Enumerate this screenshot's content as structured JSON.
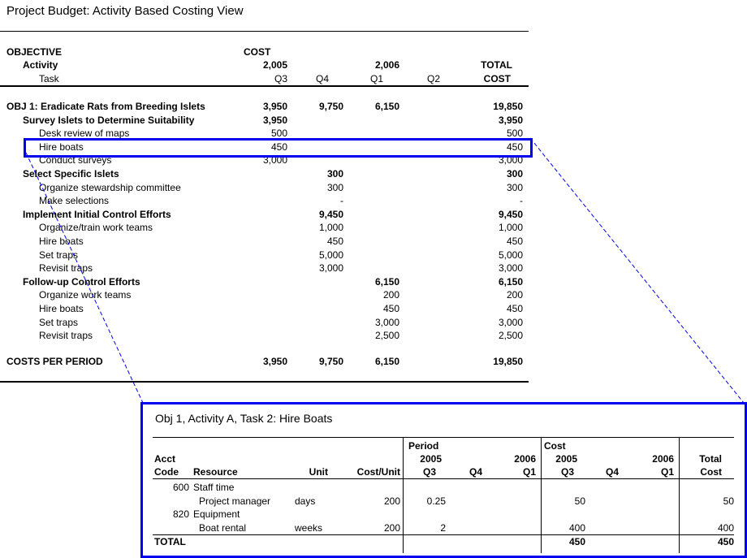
{
  "title": "Project Budget: Activity Based Costing View",
  "header": {
    "objective": "OBJECTIVE",
    "activity": "Activity",
    "task": "Task",
    "cost": "COST",
    "year_2005": "2,005",
    "year_2006": "2,006",
    "total": "TOTAL",
    "total_cost": "COST",
    "q3": "Q3",
    "q4": "Q4",
    "q1": "Q1",
    "q2": "Q2"
  },
  "rows": [
    {
      "label": "OBJ 1: Eradicate Rats from Breeding Islets",
      "level": 0,
      "q3": "3,950",
      "q4": "9,750",
      "q1": "6,150",
      "q2": "",
      "total": "19,850"
    },
    {
      "label": "Survey Islets to Determine Suitability",
      "level": 1,
      "q3": "3,950",
      "q4": "",
      "q1": "",
      "q2": "",
      "total": "3,950"
    },
    {
      "label": "Desk review of maps",
      "level": 2,
      "q3": "500",
      "q4": "",
      "q1": "",
      "q2": "",
      "total": "500"
    },
    {
      "label": "Hire boats",
      "level": 2,
      "q3": "450",
      "q4": "",
      "q1": "",
      "q2": "",
      "total": "450"
    },
    {
      "label": "Conduct surveys",
      "level": 2,
      "q3": "3,000",
      "q4": "",
      "q1": "",
      "q2": "",
      "total": "3,000"
    },
    {
      "label": "Select Specific Islets",
      "level": 1,
      "q3": "",
      "q4": "300",
      "q1": "",
      "q2": "",
      "total": "300"
    },
    {
      "label": "Organize stewardship committee",
      "level": 2,
      "q3": "",
      "q4": "300",
      "q1": "",
      "q2": "",
      "total": "300"
    },
    {
      "label": "Make selections",
      "level": 2,
      "q3": "",
      "q4": "-",
      "q1": "",
      "q2": "",
      "total": "-"
    },
    {
      "label": "Implement Initial Control Efforts",
      "level": 1,
      "q3": "",
      "q4": "9,450",
      "q1": "",
      "q2": "",
      "total": "9,450"
    },
    {
      "label": "Organize/train work teams",
      "level": 2,
      "q3": "",
      "q4": "1,000",
      "q1": "",
      "q2": "",
      "total": "1,000"
    },
    {
      "label": "Hire boats",
      "level": 2,
      "q3": "",
      "q4": "450",
      "q1": "",
      "q2": "",
      "total": "450"
    },
    {
      "label": "Set traps",
      "level": 2,
      "q3": "",
      "q4": "5,000",
      "q1": "",
      "q2": "",
      "total": "5,000"
    },
    {
      "label": "Revisit traps",
      "level": 2,
      "q3": "",
      "q4": "3,000",
      "q1": "",
      "q2": "",
      "total": "3,000"
    },
    {
      "label": "Follow-up Control Efforts",
      "level": 1,
      "q3": "",
      "q4": "",
      "q1": "6,150",
      "q2": "",
      "total": "6,150"
    },
    {
      "label": "Organize work teams",
      "level": 2,
      "q3": "",
      "q4": "",
      "q1": "200",
      "q2": "",
      "total": "200"
    },
    {
      "label": "Hire boats",
      "level": 2,
      "q3": "",
      "q4": "",
      "q1": "450",
      "q2": "",
      "total": "450"
    },
    {
      "label": "Set traps",
      "level": 2,
      "q3": "",
      "q4": "",
      "q1": "3,000",
      "q2": "",
      "total": "3,000"
    },
    {
      "label": "Revisit traps",
      "level": 2,
      "q3": "",
      "q4": "",
      "q1": "2,500",
      "q2": "",
      "total": "2,500"
    }
  ],
  "totals": {
    "label": "COSTS PER PERIOD",
    "q3": "3,950",
    "q4": "9,750",
    "q1": "6,150",
    "q2": "",
    "total": "19,850"
  },
  "detail": {
    "title": "Obj 1, Activity A, Task 2: Hire Boats",
    "headers": {
      "acct": "Acct",
      "code": "Code",
      "resource": "Resource",
      "unit": "Unit",
      "cost_unit": "Cost/Unit",
      "period": "Period",
      "cost": "Cost",
      "y2005": "2005",
      "y2006": "2006",
      "q3": "Q3",
      "q4": "Q4",
      "q1": "Q1",
      "total": "Total",
      "total_cost": "Cost"
    },
    "rows": [
      {
        "code": "600",
        "resource": "Staff time",
        "indent": false,
        "unit": "",
        "cost_unit": "",
        "p_q3": "",
        "p_q4": "",
        "p_q1": "",
        "c_q3": "",
        "c_q4": "",
        "c_q1": "",
        "total": ""
      },
      {
        "code": "",
        "resource": "Project manager",
        "indent": true,
        "unit": "days",
        "cost_unit": "200",
        "p_q3": "0.25",
        "p_q4": "",
        "p_q1": "",
        "c_q3": "50",
        "c_q4": "",
        "c_q1": "",
        "total": "50"
      },
      {
        "code": "820",
        "resource": "Equipment",
        "indent": false,
        "unit": "",
        "cost_unit": "",
        "p_q3": "",
        "p_q4": "",
        "p_q1": "",
        "c_q3": "",
        "c_q4": "",
        "c_q1": "",
        "total": ""
      },
      {
        "code": "",
        "resource": "Boat rental",
        "indent": true,
        "unit": "weeks",
        "cost_unit": "200",
        "p_q3": "2",
        "p_q4": "",
        "p_q1": "",
        "c_q3": "400",
        "c_q4": "",
        "c_q1": "",
        "total": "400"
      }
    ],
    "total_row": {
      "label": "TOTAL",
      "c_q3": "450",
      "total": "450"
    }
  },
  "colors": {
    "highlight": "#0000ee"
  }
}
